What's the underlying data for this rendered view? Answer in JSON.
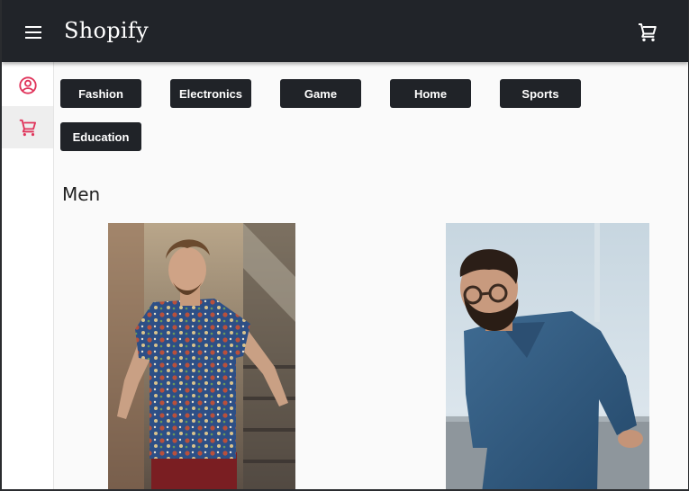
{
  "app": {
    "title": "Shopify"
  },
  "topbar": {
    "menu_icon": "menu-icon",
    "cart_icon": "shopping-cart-icon"
  },
  "sidebar": {
    "items": [
      {
        "icon": "account-circle-icon",
        "active": false
      },
      {
        "icon": "shopping-cart-icon",
        "active": true
      }
    ],
    "accent_color": "#e0335a"
  },
  "categories": [
    "Fashion",
    "Electronics",
    "Game",
    "Home",
    "Sports",
    "Education"
  ],
  "section": {
    "title": "Men"
  },
  "products": [
    {
      "image": "man-in-floral-shirt-photo"
    },
    {
      "image": "bearded-man-in-denim-shirt-photo"
    }
  ],
  "colors": {
    "topbar": "#212429",
    "button": "#202328",
    "background": "#fafafa"
  }
}
